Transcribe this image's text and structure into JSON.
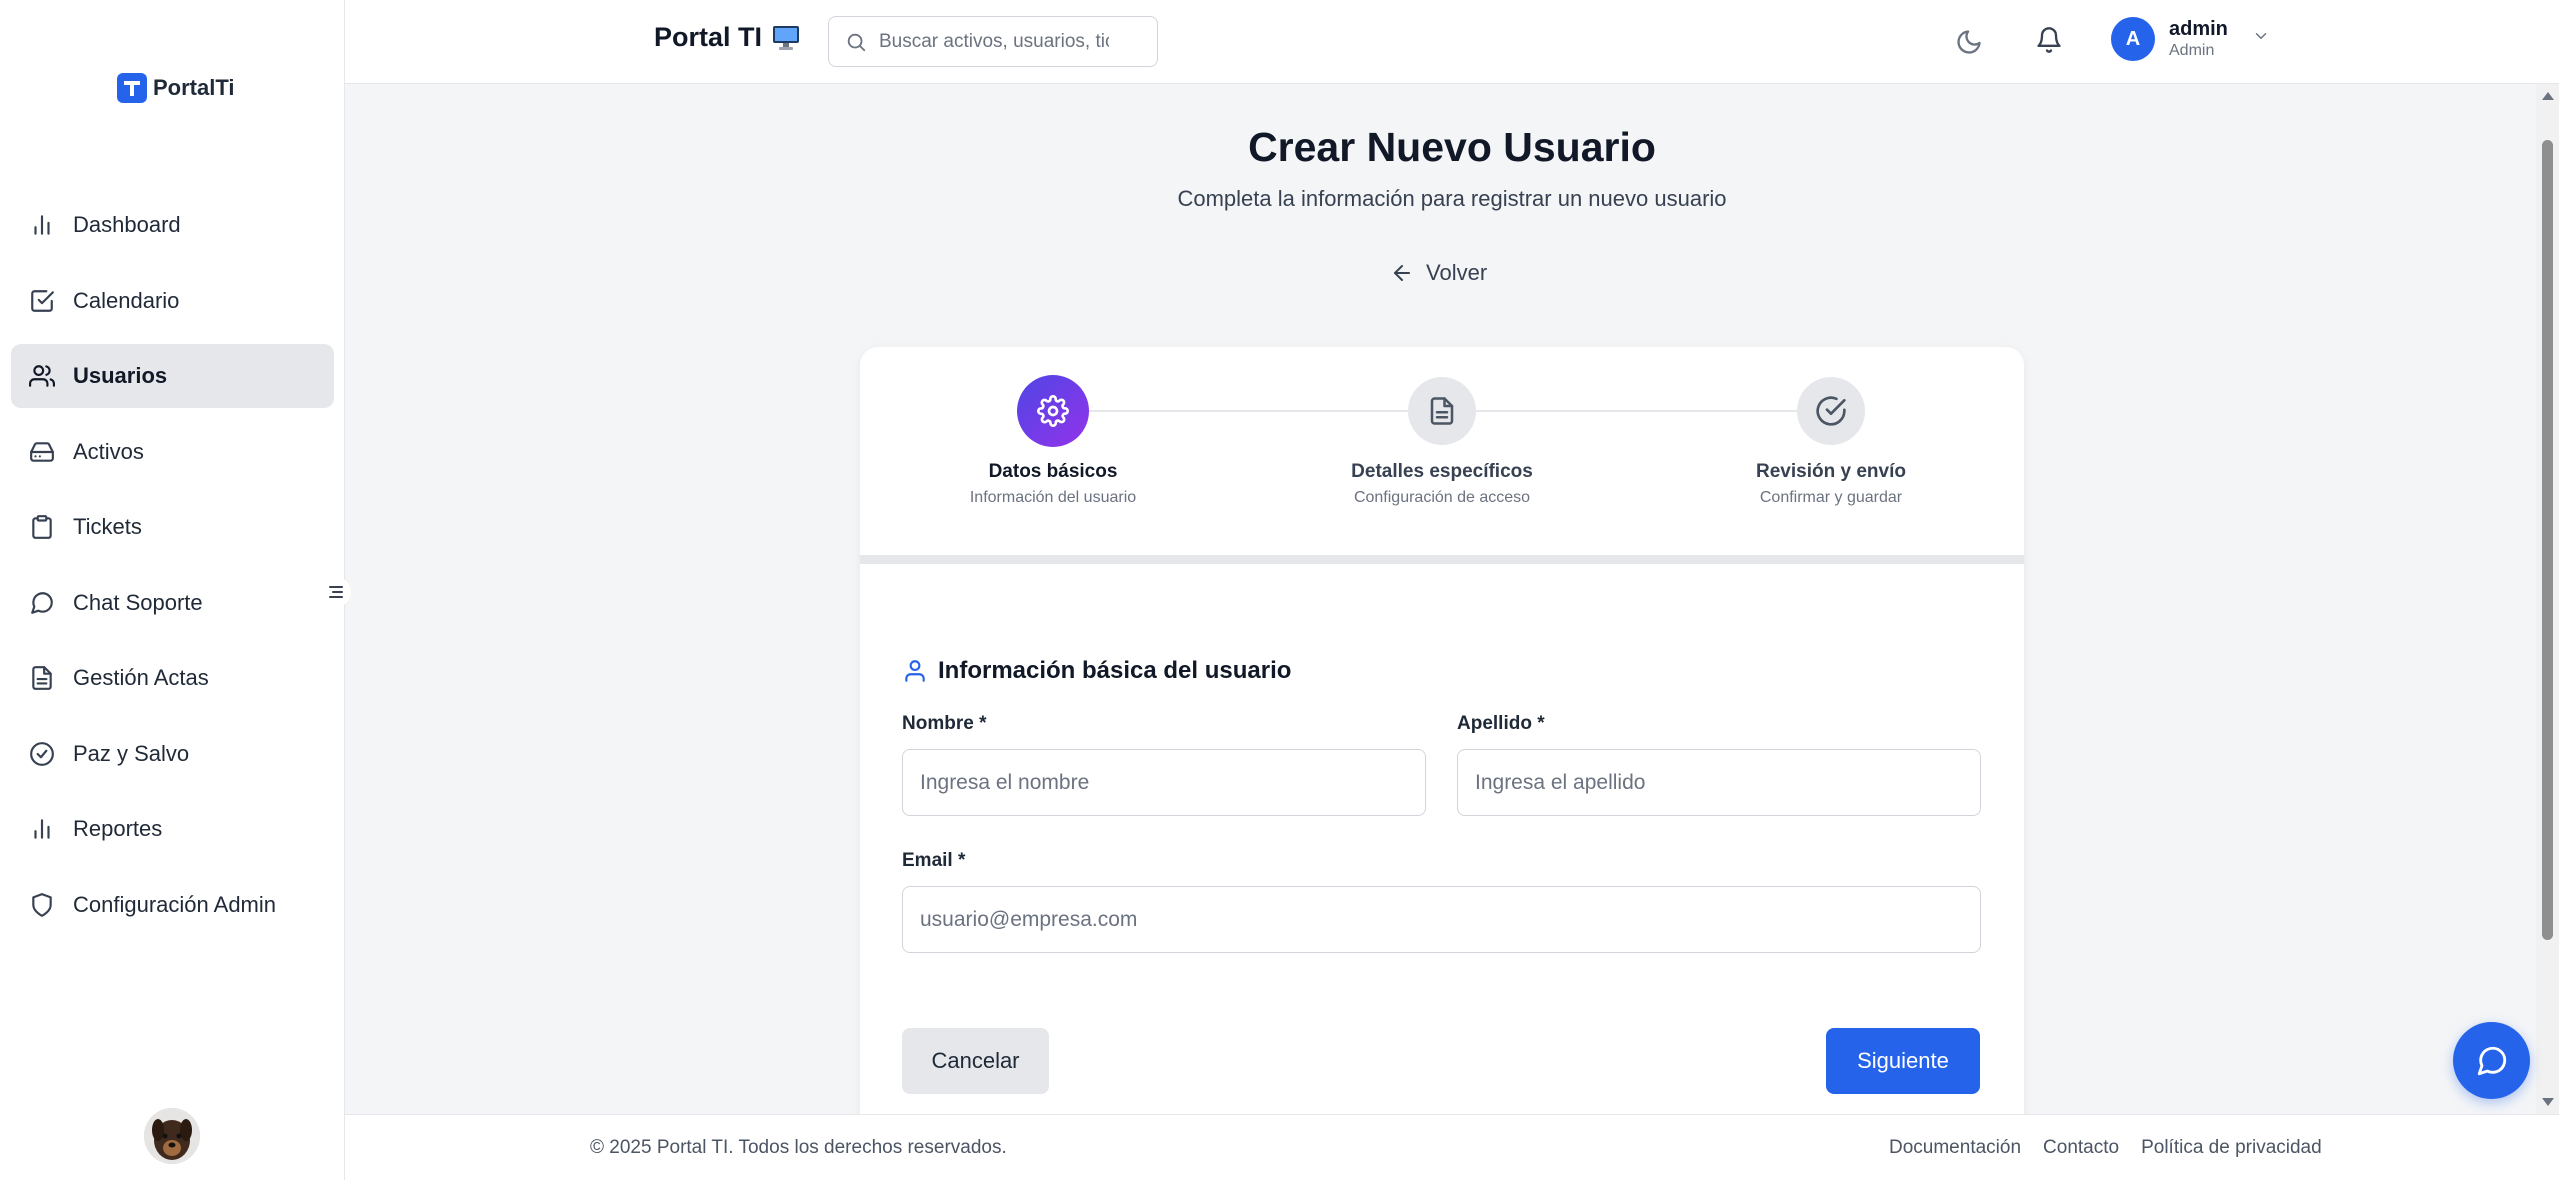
{
  "brand": {
    "logo_text": "PortalTi",
    "title": "Portal TI"
  },
  "search": {
    "placeholder": "Buscar activos, usuarios, tic"
  },
  "user": {
    "initial": "A",
    "name": "admin",
    "role": "Admin"
  },
  "sidebar": {
    "items": [
      {
        "label": "Dashboard",
        "icon": "bar-chart-icon"
      },
      {
        "label": "Calendario",
        "icon": "check-square-icon"
      },
      {
        "label": "Usuarios",
        "icon": "users-icon",
        "active": true
      },
      {
        "label": "Activos",
        "icon": "hard-drive-icon"
      },
      {
        "label": "Tickets",
        "icon": "clipboard-icon"
      },
      {
        "label": "Chat Soporte",
        "icon": "message-circle-icon"
      },
      {
        "label": "Gestión Actas",
        "icon": "file-text-icon"
      },
      {
        "label": "Paz y Salvo",
        "icon": "check-circle-icon"
      },
      {
        "label": "Reportes",
        "icon": "bar-chart-icon"
      },
      {
        "label": "Configuración Admin",
        "icon": "shield-icon"
      }
    ]
  },
  "page": {
    "title": "Crear Nuevo Usuario",
    "subtitle": "Completa la información para registrar un nuevo usuario",
    "back_label": "Volver"
  },
  "steps": [
    {
      "title": "Datos básicos",
      "desc": "Información del usuario",
      "icon": "gear-icon",
      "active": true
    },
    {
      "title": "Detalles específicos",
      "desc": "Configuración de acceso",
      "icon": "file-text-icon"
    },
    {
      "title": "Revisión y envío",
      "desc": "Confirmar y guardar",
      "icon": "check-circle-icon"
    }
  ],
  "form": {
    "section_title": "Información básica del usuario",
    "nombre_label": "Nombre *",
    "nombre_placeholder": "Ingresa el nombre",
    "nombre_value": "",
    "apellido_label": "Apellido *",
    "apellido_placeholder": "Ingresa el apellido",
    "apellido_value": "",
    "email_label": "Email *",
    "email_placeholder": "usuario@empresa.com",
    "email_value": "",
    "cancel_label": "Cancelar",
    "next_label": "Siguiente"
  },
  "footer": {
    "copyright": "© 2025 Portal TI. Todos los derechos reservados.",
    "links": [
      "Documentación",
      "Contacto",
      "Política de privacidad"
    ]
  },
  "colors": {
    "primary": "#2563eb",
    "step_gradient_start": "#4f46e5",
    "step_gradient_end": "#9333ea"
  }
}
